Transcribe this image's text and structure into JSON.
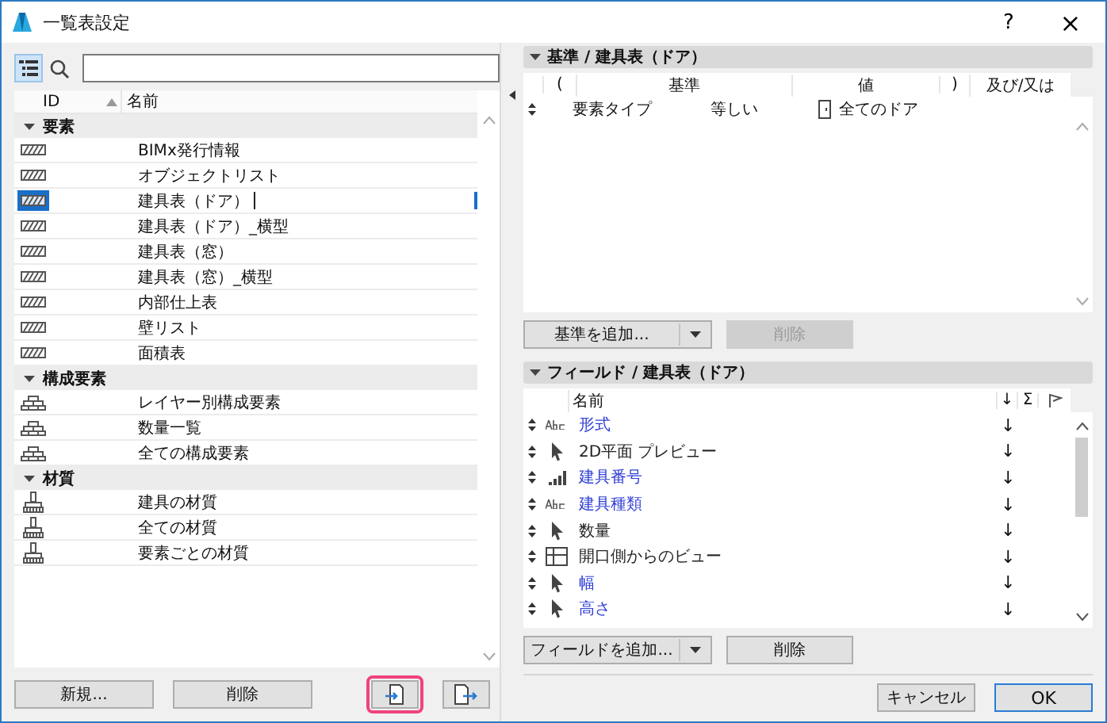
{
  "window": {
    "title": "一覧表設定",
    "help": "?",
    "close": "×"
  },
  "left": {
    "columns": [
      "ID",
      "名前"
    ],
    "groups": [
      {
        "label": "要素",
        "expanded": true,
        "kind": "element",
        "items": [
          {
            "name": "BIMx発行情報",
            "selected": false
          },
          {
            "name": "オブジェクトリスト",
            "selected": false
          },
          {
            "name": "建具表（ドア）",
            "selected": true
          },
          {
            "name": "建具表（ドア）_横型",
            "selected": false
          },
          {
            "name": "建具表（窓）",
            "selected": false
          },
          {
            "name": "建具表（窓）_横型",
            "selected": false
          },
          {
            "name": "内部仕上表",
            "selected": false
          },
          {
            "name": "壁リスト",
            "selected": false
          },
          {
            "name": "面積表",
            "selected": false
          }
        ]
      },
      {
        "label": "構成要素",
        "expanded": true,
        "kind": "component",
        "items": [
          {
            "name": "レイヤー別構成要素",
            "selected": false
          },
          {
            "name": "数量一覧",
            "selected": false
          },
          {
            "name": "全ての構成要素",
            "selected": false
          }
        ]
      },
      {
        "label": "材質",
        "expanded": true,
        "kind": "material",
        "items": [
          {
            "name": "建具の材質",
            "selected": false
          },
          {
            "name": "全ての材質",
            "selected": false
          },
          {
            "name": "要素ごとの材質",
            "selected": false
          }
        ]
      }
    ],
    "buttons": [
      {
        "label": "新規..."
      },
      {
        "label": "削除"
      }
    ]
  },
  "criteria": {
    "title": "基準 /  建具表（ドア）",
    "columns": [
      "(",
      "基準",
      "値",
      ")",
      "及び/又は"
    ],
    "rows": [
      {
        "criterion": "要素タイプ",
        "operator": "等しい",
        "value": "全てのドア"
      }
    ],
    "add_button": "基準を追加...",
    "delete_button": {
      "label": "削除",
      "disabled": true
    }
  },
  "fields": {
    "title": "フィールド /  建具表（ドア）",
    "columns": {
      "name": "名前",
      "sort": "↓",
      "sum": "Σ"
    },
    "rows": [
      {
        "kind": "text",
        "name": "形式",
        "linked": true,
        "sort": "↓"
      },
      {
        "kind": "pointer",
        "name": "2D平面 プレビュー",
        "linked": false,
        "sort": "↓"
      },
      {
        "kind": "number",
        "name": "建具番号",
        "linked": true,
        "sort": "↓"
      },
      {
        "kind": "text",
        "name": "建具種類",
        "linked": true,
        "sort": "↓"
      },
      {
        "kind": "pointer",
        "name": "数量",
        "linked": false,
        "sort": "↓"
      },
      {
        "kind": "view",
        "name": "開口側からのビュー",
        "linked": false,
        "sort": "↓"
      },
      {
        "kind": "pointer",
        "name": "幅",
        "linked": true,
        "sort": "↓"
      },
      {
        "kind": "pointer",
        "name": "高さ",
        "linked": true,
        "sort": "↓"
      }
    ],
    "add_button": "フィールドを追加...",
    "delete_button": {
      "label": "削除",
      "disabled": false
    }
  },
  "footer": {
    "cancel": "キャンセル",
    "ok": "OK"
  }
}
